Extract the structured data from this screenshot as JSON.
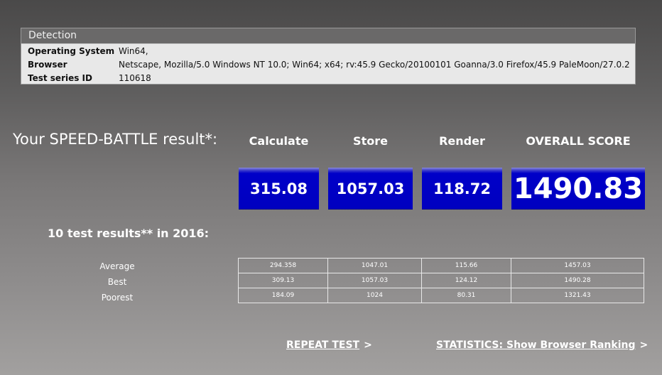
{
  "detection": {
    "title": "Detection",
    "rows": [
      {
        "label": "Operating System",
        "value": "Win64,"
      },
      {
        "label": "Browser",
        "value": "Netscape, Mozilla/5.0 Windows NT 10.0; Win64; x64; rv:45.9 Gecko/20100101 Goanna/3.0 Firefox/45.9 PaleMoon/27.0.2"
      },
      {
        "label": "Test series ID",
        "value": "110618"
      }
    ]
  },
  "result": {
    "title": "Your SPEED-BATTLE result*:",
    "columns": {
      "calculate": "Calculate",
      "store": "Store",
      "render": "Render",
      "overall": "OVERALL SCORE"
    },
    "scores": {
      "calculate": "315.08",
      "store": "1057.03",
      "render": "118.72",
      "overall": "1490.83"
    },
    "colors": {
      "score_box": "#0000c0"
    }
  },
  "history": {
    "title": "10 test results** in 2016:",
    "rows": [
      {
        "label": "Average",
        "calculate": "294.358",
        "store": "1047.01",
        "render": "115.66",
        "overall": "1457.03"
      },
      {
        "label": "Best",
        "calculate": "309.13",
        "store": "1057.03",
        "render": "124.12",
        "overall": "1490.28"
      },
      {
        "label": "Poorest",
        "calculate": "184.09",
        "store": "1024",
        "render": "80.31",
        "overall": "1321.43"
      }
    ]
  },
  "links": {
    "repeat": {
      "label": "REPEAT TEST",
      "arrow": ">"
    },
    "statistics": {
      "label": "STATISTICS: Show Browser Ranking",
      "arrow": ">"
    }
  }
}
